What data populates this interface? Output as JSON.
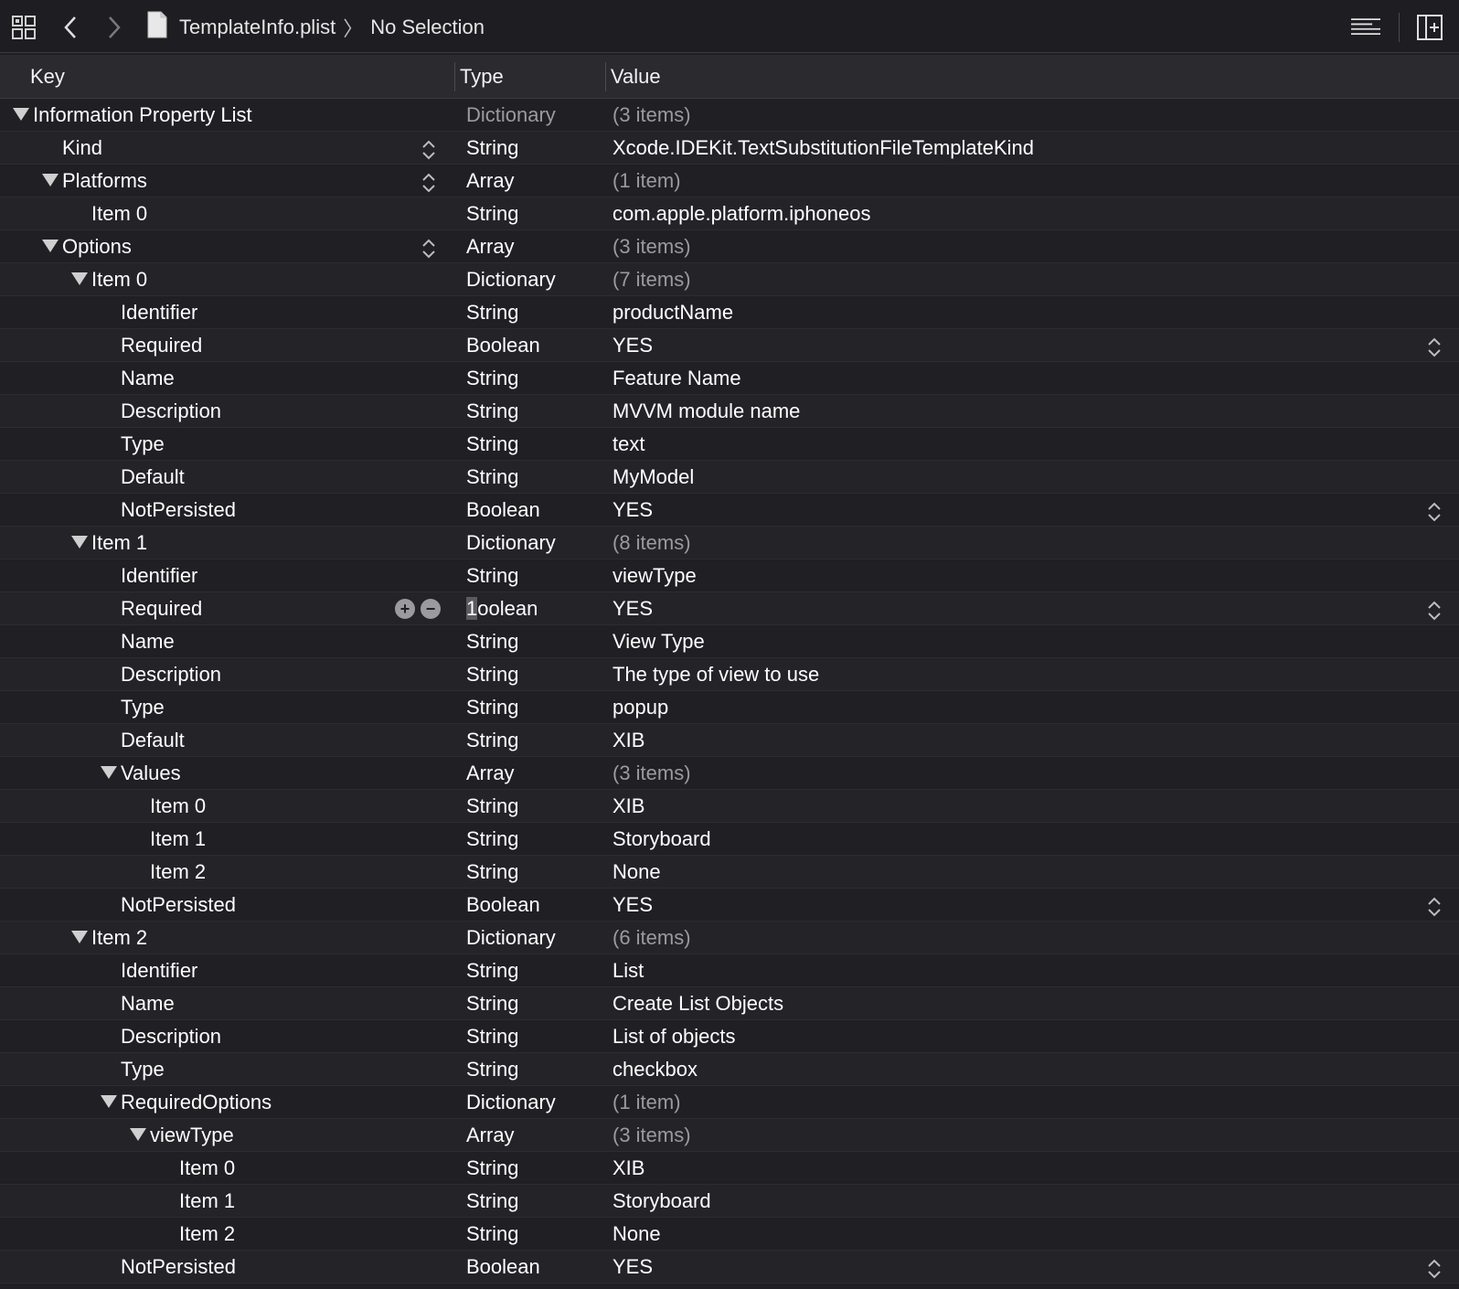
{
  "toolbar": {
    "file_name": "TemplateInfo.plist",
    "selection": "No Selection",
    "separator": "〉"
  },
  "columns": {
    "key": "Key",
    "type": "Type",
    "value": "Value"
  },
  "rows": [
    {
      "key": "Information Property List",
      "type": "Dictionary",
      "value": "(3 items)",
      "level": 0,
      "expanded": true,
      "type_dim": true,
      "value_dim": true
    },
    {
      "key": "Kind",
      "type": "String",
      "value": "Xcode.IDEKit.TextSubstitutionFileTemplateKind",
      "level": 1,
      "key_stepper": true
    },
    {
      "key": "Platforms",
      "type": "Array",
      "value": "(1 item)",
      "level": 1,
      "expanded": true,
      "key_stepper": true,
      "value_dim": true
    },
    {
      "key": "Item 0",
      "type": "String",
      "value": "com.apple.platform.iphoneos",
      "level": 2
    },
    {
      "key": "Options",
      "type": "Array",
      "value": "(3 items)",
      "level": 1,
      "expanded": true,
      "key_stepper": true,
      "value_dim": true
    },
    {
      "key": "Item 0",
      "type": "Dictionary",
      "value": "(7 items)",
      "level": 2,
      "expanded": true,
      "value_dim": true
    },
    {
      "key": "Identifier",
      "type": "String",
      "value": "productName",
      "level": 3
    },
    {
      "key": "Required",
      "type": "Boolean",
      "value": "YES",
      "level": 3,
      "value_stepper": true
    },
    {
      "key": "Name",
      "type": "String",
      "value": "Feature Name",
      "level": 3
    },
    {
      "key": "Description",
      "type": "String",
      "value": "MVVM module name",
      "level": 3
    },
    {
      "key": "Type",
      "type": "String",
      "value": "text",
      "level": 3
    },
    {
      "key": "Default",
      "type": "String",
      "value": "MyModel",
      "level": 3
    },
    {
      "key": "NotPersisted",
      "type": "Boolean",
      "value": "YES",
      "level": 3,
      "value_stepper": true
    },
    {
      "key": "Item 1",
      "type": "Dictionary",
      "value": "(8 items)",
      "level": 2,
      "expanded": true,
      "value_dim": true
    },
    {
      "key": "Identifier",
      "type": "String",
      "value": "viewType",
      "level": 3
    },
    {
      "key": "Required",
      "type": "oolean",
      "type_cursor": "1",
      "value": "YES",
      "level": 3,
      "value_stepper": true,
      "add_remove": true
    },
    {
      "key": "Name",
      "type": "String",
      "value": "View Type",
      "level": 3
    },
    {
      "key": "Description",
      "type": "String",
      "value": "The type of view to use",
      "level": 3
    },
    {
      "key": "Type",
      "type": "String",
      "value": "popup",
      "level": 3
    },
    {
      "key": "Default",
      "type": "String",
      "value": "XIB",
      "level": 3
    },
    {
      "key": "Values",
      "type": "Array",
      "value": "(3 items)",
      "level": 3,
      "expanded": true,
      "value_dim": true
    },
    {
      "key": "Item 0",
      "type": "String",
      "value": "XIB",
      "level": 4
    },
    {
      "key": "Item 1",
      "type": "String",
      "value": "Storyboard",
      "level": 4
    },
    {
      "key": "Item 2",
      "type": "String",
      "value": "None",
      "level": 4
    },
    {
      "key": "NotPersisted",
      "type": "Boolean",
      "value": "YES",
      "level": 3,
      "value_stepper": true
    },
    {
      "key": "Item 2",
      "type": "Dictionary",
      "value": "(6 items)",
      "level": 2,
      "expanded": true,
      "value_dim": true
    },
    {
      "key": "Identifier",
      "type": "String",
      "value": "List",
      "level": 3
    },
    {
      "key": "Name",
      "type": "String",
      "value": "Create List Objects",
      "level": 3
    },
    {
      "key": "Description",
      "type": "String",
      "value": "List of objects",
      "level": 3
    },
    {
      "key": "Type",
      "type": "String",
      "value": "checkbox",
      "level": 3
    },
    {
      "key": "RequiredOptions",
      "type": "Dictionary",
      "value": "(1 item)",
      "level": 3,
      "expanded": true,
      "value_dim": true
    },
    {
      "key": "viewType",
      "type": "Array",
      "value": "(3 items)",
      "level": 4,
      "expanded": true,
      "value_dim": true
    },
    {
      "key": "Item 0",
      "type": "String",
      "value": "XIB",
      "level": 5
    },
    {
      "key": "Item 1",
      "type": "String",
      "value": "Storyboard",
      "level": 5
    },
    {
      "key": "Item 2",
      "type": "String",
      "value": "None",
      "level": 5
    },
    {
      "key": "NotPersisted",
      "type": "Boolean",
      "value": "YES",
      "level": 3,
      "value_stepper": true
    }
  ]
}
